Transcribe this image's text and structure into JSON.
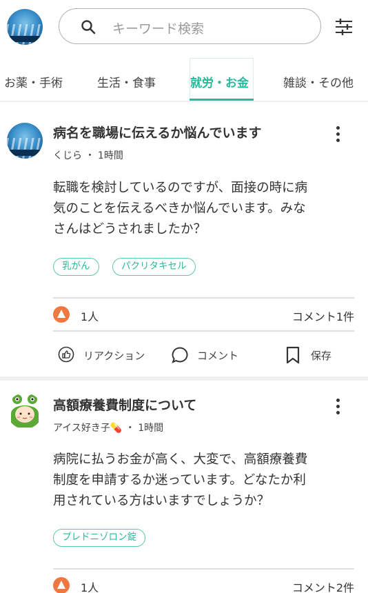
{
  "header": {
    "avatar_icon": "whale-wave-avatar",
    "search_placeholder": "キーワード検索",
    "search_icon": "search-icon",
    "filter_icon": "sliders-icon"
  },
  "tabs": [
    {
      "label": "お薬・手術",
      "active": false
    },
    {
      "label": "生活・食事",
      "active": false
    },
    {
      "label": "就労・お金",
      "active": true
    },
    {
      "label": "雑談・その他",
      "active": false
    }
  ],
  "accent_color": "#28b89a",
  "reaction_color": "#f0773f",
  "posts": [
    {
      "title": "病名を職場に伝えるか悩んでいます",
      "author": "くじら",
      "time": "1時間",
      "body_lines": [
        "転職を検討しているのですが、面接の時に病",
        "気のことを伝えるべきか悩んでいます。みな",
        "さんはどうされましたか？"
      ],
      "tags": [
        "乳がん",
        "パクリタキセル"
      ],
      "reactions": "1人",
      "comments": "コメント1件"
    },
    {
      "title": "高額療養費制度について",
      "author": "アイス好き子💊",
      "time": "1時間",
      "body_lines": [
        "病院に払うお金が高く、大変で、高額療養費",
        "制度を申請するか迷っています。どなたか利",
        "用されている方はいますでしょうか？"
      ],
      "tags": [
        "プレドニゾロン錠"
      ],
      "reactions": "1人",
      "comments": "コメント2件"
    }
  ],
  "actions": {
    "reaction": "リアクション",
    "comment": "コメント",
    "save": "保存"
  }
}
